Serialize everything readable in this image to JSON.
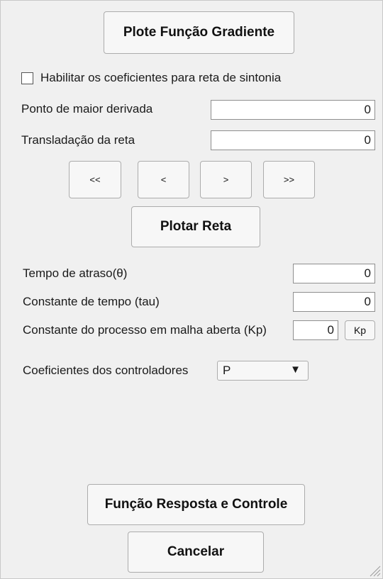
{
  "buttons": {
    "plot_gradient": "Plote Função Gradiente",
    "nav_first": "<<",
    "nav_prev": "<",
    "nav_next": ">",
    "nav_last": ">>",
    "plot_line": "Plotar Reta",
    "kp": "Kp",
    "response_control": "Função Resposta e Controle",
    "cancel": "Cancelar"
  },
  "tuning": {
    "enable_checkbox_label": "Habilitar os coeficientes para reta de sintonia",
    "enable_checked": false,
    "max_derivative_label": "Ponto de maior derivada",
    "max_derivative_value": "0",
    "translation_label": "Transladação da reta",
    "translation_value": "0"
  },
  "process": {
    "delay_label": "Tempo de atraso(θ)",
    "delay_value": "0",
    "time_constant_label": "Constante de tempo (tau)",
    "time_constant_value": "0",
    "gain_label": "Constante do processo em malha aberta (Kp)",
    "gain_value": "0"
  },
  "controller": {
    "label": "Coeficientes dos controladores",
    "selected": "P",
    "arrow_icon": "triangle-down-icon"
  }
}
